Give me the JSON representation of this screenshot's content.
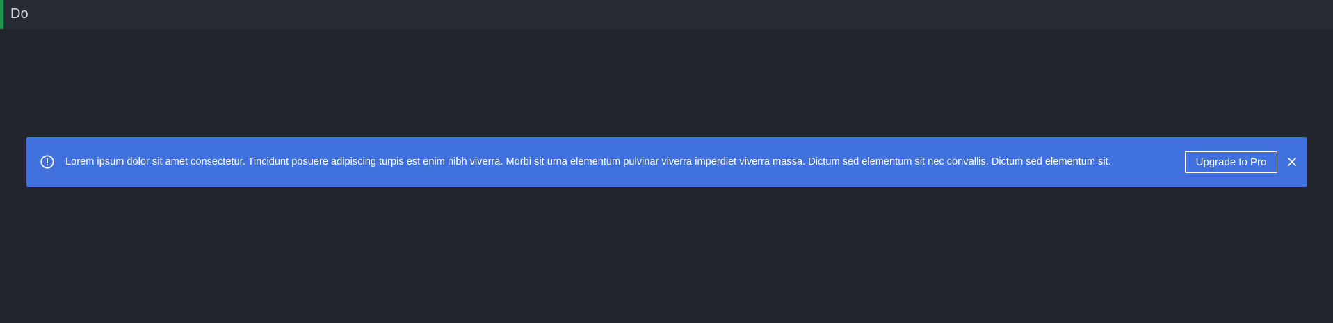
{
  "header": {
    "title": "Do"
  },
  "banner": {
    "icon": "alert-circle-icon",
    "message": "Lorem ipsum dolor sit amet consectetur. Tincidunt posuere adipiscing turpis est enim nibh viverra. Morbi sit urna elementum pulvinar viverra imperdiet viverra massa. Dictum sed elementum sit nec convallis. Dictum sed elementum sit.",
    "button_label": "Upgrade to Pro",
    "close_icon": "close-icon",
    "background_color": "#4071dc"
  },
  "colors": {
    "page_background": "#22252d",
    "header_accent": "#1f8f4e"
  }
}
